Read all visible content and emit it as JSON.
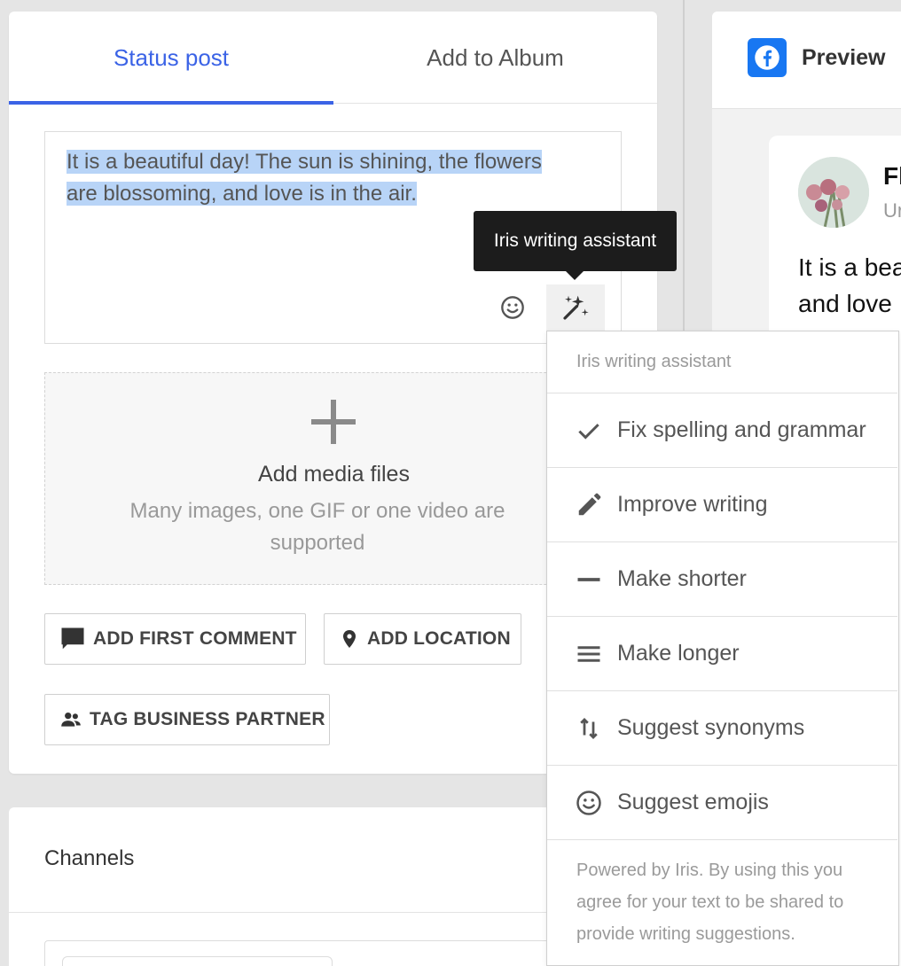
{
  "composer": {
    "tabs": [
      {
        "label": "Status post",
        "active": true
      },
      {
        "label": "Add to Album",
        "active": false
      }
    ],
    "text_line_1": "It is a beautiful day! The sun is shining, the flowers",
    "text_line_2": "are blossoming, and love is in the air.",
    "media": {
      "title": "Add media files",
      "subtitle": "Many images, one GIF or one video are supported"
    },
    "buttons": {
      "first_comment": "ADD FIRST COMMENT",
      "location": "ADD LOCATION",
      "tag_partner": "TAG BUSINESS PARTNER"
    }
  },
  "tooltip": {
    "text": "Iris writing assistant"
  },
  "assistant_menu": {
    "header": "Iris writing assistant",
    "items": [
      {
        "label": "Fix spelling and grammar",
        "icon": "check-icon"
      },
      {
        "label": "Improve writing",
        "icon": "pencil-icon"
      },
      {
        "label": "Make shorter",
        "icon": "minus-icon"
      },
      {
        "label": "Make longer",
        "icon": "lines-icon"
      },
      {
        "label": "Suggest synonyms",
        "icon": "swap-vertical-icon"
      },
      {
        "label": "Suggest emojis",
        "icon": "smiley-icon"
      }
    ],
    "footer": "Powered by Iris. By using this you agree for your text to be shared to provide writing suggestions."
  },
  "channels": {
    "title": "Channels"
  },
  "preview": {
    "title": "Preview",
    "post_name": "Fl",
    "post_meta": "Ur",
    "post_text_line_1": "It is a bea",
    "post_text_line_2": "and love"
  },
  "colors": {
    "accent": "#3b63e6",
    "selection": "#b8d4f7",
    "facebook": "#1877f2",
    "tooltip_bg": "#1c1c1c"
  }
}
